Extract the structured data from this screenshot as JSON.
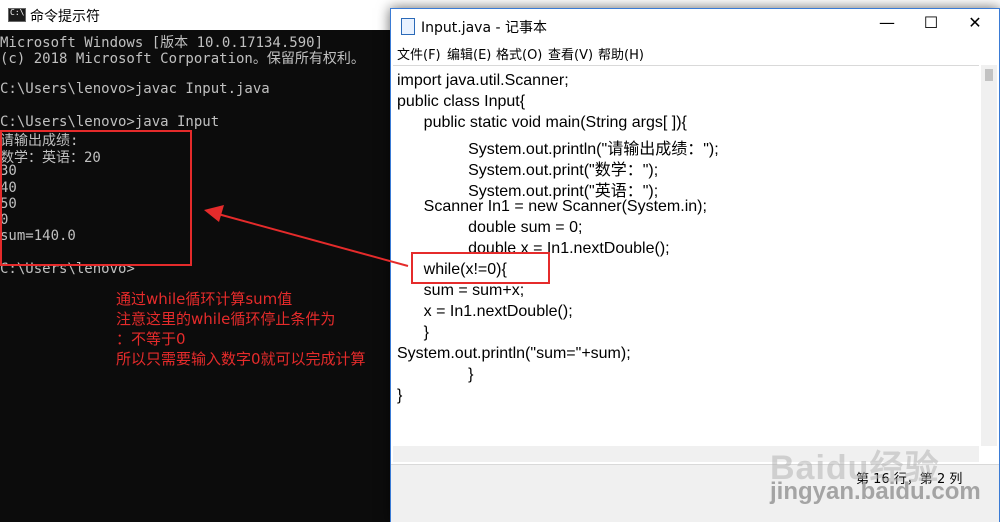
{
  "cmd": {
    "title": "命令提示符",
    "lines": [
      "Microsoft Windows [版本 10.0.17134.590]",
      "(c) 2018 Microsoft Corporation。保留所有权利。",
      "",
      "C:\\Users\\lenovo>javac Input.java",
      "",
      "C:\\Users\\lenovo>java Input",
      "请输出成绩:",
      "数学：英语：20",
      "30",
      "40",
      "50",
      "0",
      "sum=140.0",
      "",
      "C:\\Users\\lenovo>"
    ]
  },
  "annotation": {
    "lines": [
      "通过while循环计算sum值",
      "注意这里的while循环停止条件为",
      "：不等于0",
      "所以只需要输入数字0就可以完成计算"
    ],
    "color": "#e52b2b"
  },
  "notepad": {
    "title": "Input.java - 记事本",
    "controls": [
      "—",
      "☐",
      "✕"
    ],
    "menu": [
      "文件(F)",
      "编辑(E)",
      "格式(O)",
      "查看(V)",
      "帮助(H)"
    ],
    "code": [
      "import java.util.Scanner;",
      "public class Input{",
      "      public static void main(String args[ ]){",
      "                System.out.println(\"请输出成绩：\");",
      "                System.out.print(\"数学：\");",
      "                System.out.print(\"英语：\");",
      "      Scanner In1 = new Scanner(System.in);",
      "                double sum = 0;",
      "                double x = In1.nextDouble();",
      "      while(x!=0){",
      "      sum = sum+x;",
      "      x = In1.nextDouble();",
      "      }",
      "System.out.println(\"sum=\"+sum);",
      "                }",
      "}"
    ],
    "status": "第 16 行，第 2 列"
  },
  "watermark": {
    "logo": "Baidu经验",
    "url": "jingyan.baidu.com"
  }
}
